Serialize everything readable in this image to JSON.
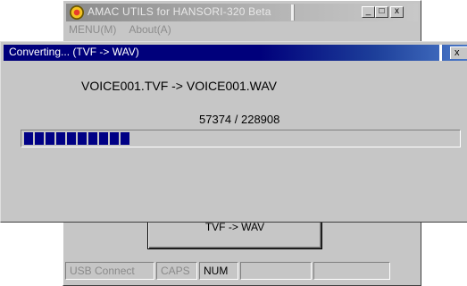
{
  "main_window": {
    "title": "AMAC UTILS for HANSORI-320 Beta",
    "menu": [
      "MENU(M)",
      "About(A)"
    ],
    "window_buttons": {
      "minimize": "_",
      "maximize": "□",
      "close": "x"
    },
    "convert_button_label": "TVF -> WAV",
    "status": [
      "USB Connect",
      "CAPS",
      "NUM",
      "",
      ""
    ]
  },
  "dialog": {
    "title": "Converting... (TVF -> WAV)",
    "close_label": "x",
    "filename_line": "VOICE001.TVF  ->  VOICE001.WAV",
    "progress_text": "57374 / 228908",
    "progress_current": 57374,
    "progress_total": 228908
  },
  "colors": {
    "titlebar_active": "#00007b",
    "progress_block": "#000085",
    "face": "#c6c6c6"
  }
}
